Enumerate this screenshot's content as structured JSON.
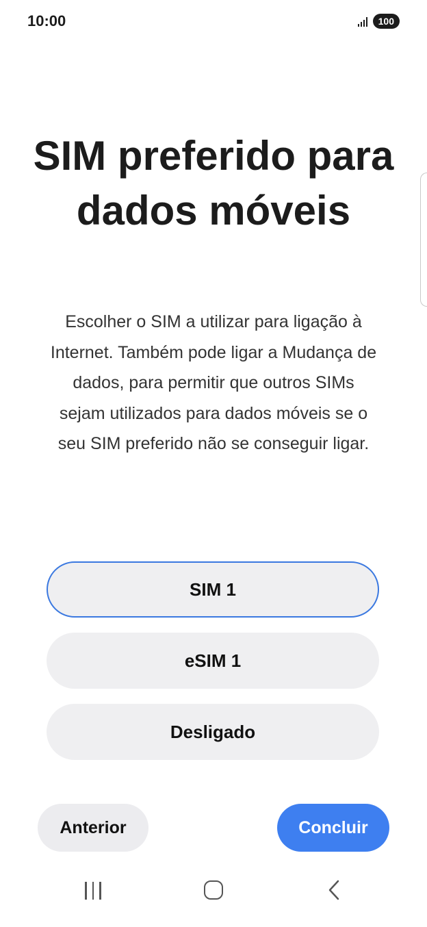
{
  "status_bar": {
    "time": "10:00",
    "battery": "100"
  },
  "header": {
    "title": "SIM preferido para dados móveis",
    "description": "Escolher o SIM a utilizar para ligação à Internet. Também pode ligar a Mudança de dados, para permitir que outros SIMs sejam utilizados para dados móveis se o seu SIM preferido não se conseguir ligar."
  },
  "options": [
    {
      "label": "SIM 1",
      "selected": true
    },
    {
      "label": "eSIM 1",
      "selected": false
    },
    {
      "label": "Desligado",
      "selected": false
    }
  ],
  "buttons": {
    "previous_label": "Anterior",
    "done_label": "Concluir"
  },
  "colors": {
    "accent": "#3e7ff0",
    "selected_border": "#3a78e0",
    "option_bg": "#efeff1"
  },
  "icons": {
    "signal": "signal-icon",
    "recent_apps": "recent-apps-icon",
    "home": "home-icon",
    "back": "back-icon"
  }
}
